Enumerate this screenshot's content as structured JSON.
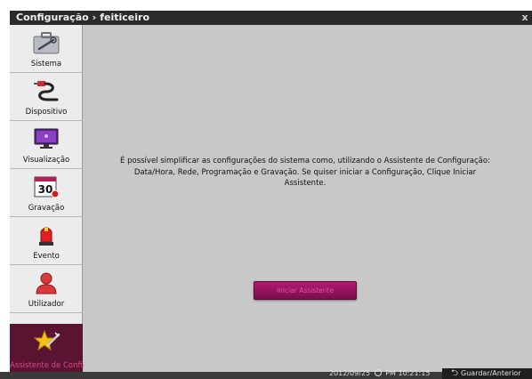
{
  "title": {
    "section": "Configuração",
    "separator": "›",
    "page": "feiticeiro",
    "close": "x"
  },
  "sidebar": {
    "items": [
      {
        "label": "Sistema",
        "icon": "toolbox-icon"
      },
      {
        "label": "Dispositivo",
        "icon": "cable-plug-icon"
      },
      {
        "label": "Visualização",
        "icon": "monitor-icon"
      },
      {
        "label": "Gravação",
        "icon": "calendar-icon",
        "badge": "30"
      },
      {
        "label": "Evento",
        "icon": "alarm-siren-icon"
      },
      {
        "label": "Utilizador",
        "icon": "user-icon"
      },
      {
        "label": "Assistente de Configuração",
        "icon": "star-wand-icon",
        "active": true
      }
    ]
  },
  "main": {
    "message": "É possível simplificar as configurações do sistema como, utilizando o Assistente de Configuração: Data/Hora, Rede, Programação e Gravação. Se quiser iniciar a Configuração, Clique Iniciar Assistente.",
    "start_button": "Iniciar Assistente"
  },
  "status": {
    "date": "2012/09/25",
    "time": "PM 10:21:15",
    "save_back": "Guardar/Anterior"
  },
  "colors": {
    "accent": "#a4165f",
    "active_sidebar": "#5a1432",
    "active_text": "#d94a8a",
    "titlebar": "#2b2b2b"
  }
}
